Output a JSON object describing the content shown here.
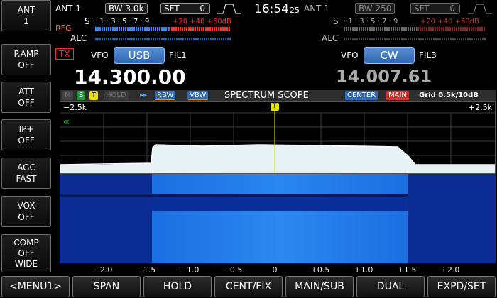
{
  "side": {
    "ant": {
      "label": "ANT",
      "value": "1"
    },
    "pamp": {
      "label": "P.AMP",
      "value": "OFF"
    },
    "att": {
      "label": "ATT",
      "value": "OFF"
    },
    "ip": {
      "label": "IP+",
      "value": "OFF"
    },
    "agc": {
      "label": "AGC",
      "value": "FAST"
    },
    "vox": {
      "label": "VOX",
      "value": "OFF"
    },
    "comp": {
      "label": "COMP",
      "value": "OFF",
      "value2": "WIDE"
    }
  },
  "main": {
    "ant": "ANT 1",
    "bw": "BW 3.0k",
    "sft_label": "SFT",
    "sft_value": "0",
    "rfg": "RFG",
    "s": "S",
    "s_scale": "· 1 · 3 · 5 · 7 · 9",
    "plus_scale": "+20  +40  +60dB",
    "alc": "ALC",
    "tx": "TX",
    "vfo": "VFO",
    "mode": "USB",
    "fil": "FIL1",
    "freq": "14.300.00"
  },
  "clock": {
    "time": "16:54",
    "sec": "25"
  },
  "sub": {
    "ant": "ANT 1",
    "bw": "BW 250",
    "sft_label": "SFT",
    "sft_value": "0",
    "s": "S",
    "s_scale": "· 1 · 3 · 5 · 7 · 9",
    "plus_scale": "+20 +40 +60dB",
    "alc": "ALC",
    "vfo": "VFO",
    "mode": "CW",
    "fil": "FIL3",
    "freq": "14.007.61"
  },
  "scope": {
    "m": "M",
    "s": "S",
    "t": "T",
    "hold": "HOLD",
    "ff": "▸▸",
    "rbw": "RBW",
    "vbw": "VBW",
    "title": "SPECTRUM SCOPE",
    "center": "CENTER",
    "main": "MAIN",
    "grid": "Grid 0.5k/10dB",
    "left_edge": "−2.5k",
    "right_edge": "+2.5k",
    "marker": "T",
    "arrow": "«",
    "axis": [
      "−2.0",
      "−1.5",
      "−1.0",
      "−0.5",
      "0",
      "+0.5",
      "+1.0",
      "+1.5",
      "+2.0"
    ]
  },
  "menu": [
    "<MENU1>",
    "SPAN",
    "HOLD",
    "CENT/FIX",
    "MAIN/SUB",
    "DUAL",
    "EXPD/SET"
  ]
}
